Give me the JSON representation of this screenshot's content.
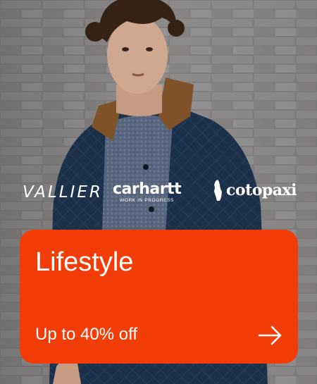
{
  "hero": {
    "image_description_icon": "person-photo-icon"
  },
  "brands": {
    "vallier": "VALLIER",
    "carhartt": "carhartt",
    "carhartt_tagline": "WORK IN PROGRESS",
    "cotopaxi": "cotopaxi"
  },
  "offer": {
    "title": "Lifestyle",
    "subtitle": "Up to 40% off",
    "arrow_icon": "arrow-right-icon"
  },
  "colors": {
    "accent": "#f23d08",
    "text": "#ffffff"
  }
}
